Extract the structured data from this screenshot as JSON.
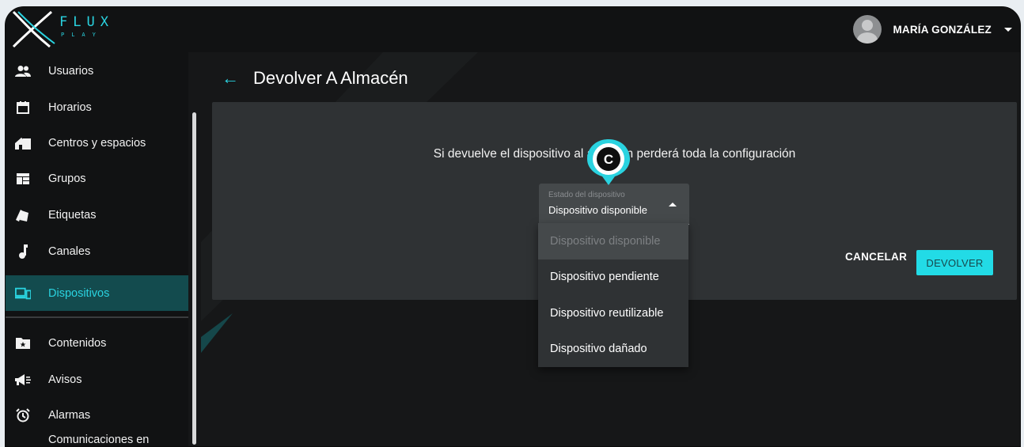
{
  "app": {
    "logo_text": "FLUX",
    "logo_sub": "PLAY"
  },
  "header": {
    "user_name": "MARÍA GONZÁLEZ"
  },
  "sidebar": {
    "items": [
      {
        "label": "Usuarios",
        "icon": "users-icon"
      },
      {
        "label": "Horarios",
        "icon": "calendar-icon"
      },
      {
        "label": "Centros y espacios",
        "icon": "home-icon"
      },
      {
        "label": "Grupos",
        "icon": "grid-icon"
      },
      {
        "label": "Etiquetas",
        "icon": "tags-icon"
      },
      {
        "label": "Canales",
        "icon": "music-note-icon"
      },
      {
        "label": "Dispositivos",
        "icon": "devices-icon",
        "active": true
      },
      {
        "label": "Contenidos",
        "icon": "folder-star-icon"
      },
      {
        "label": "Avisos",
        "icon": "megaphone-icon"
      },
      {
        "label": "Alarmas",
        "icon": "alarm-icon"
      },
      {
        "label": "Comunicaciones en",
        "icon": "broadcast-icon"
      }
    ]
  },
  "page": {
    "title": "Devolver A Almacén",
    "message": "Si devuelve el dispositivo al almacén perderá toda la configuración"
  },
  "select": {
    "label": "Estado del dispositivo",
    "value": "Dispositivo disponible",
    "options": [
      {
        "label": "Dispositivo disponible",
        "disabled": true
      },
      {
        "label": "Dispositivo pendiente"
      },
      {
        "label": "Dispositivo reutilizable"
      },
      {
        "label": "Dispositivo dañado"
      }
    ]
  },
  "actions": {
    "cancel_label": "CANCELAR",
    "return_label": "DEVOLVER"
  },
  "annotation": {
    "marker_letter": "C"
  },
  "colors": {
    "accent": "#2ad3e0",
    "button": "#22dbe6",
    "card": "#2f3234",
    "sidebar_active": "#134b4e"
  }
}
